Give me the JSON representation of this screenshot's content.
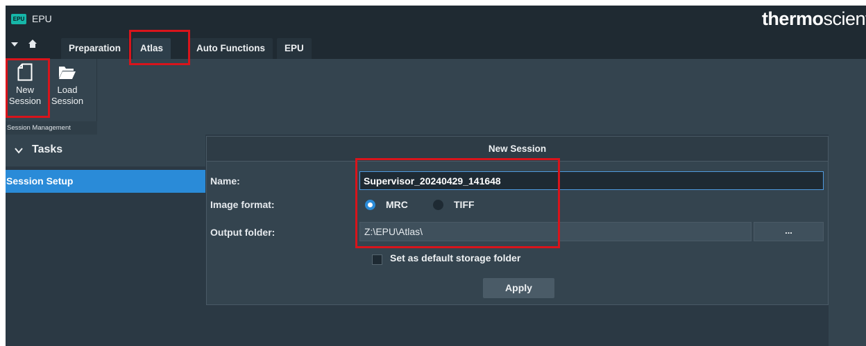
{
  "app": {
    "logo_text": "EPU",
    "title": "EPU",
    "brand_bold": "thermo",
    "brand_light": "scient"
  },
  "tabs": [
    {
      "label": "Preparation",
      "active": false
    },
    {
      "label": "Atlas",
      "active": true
    },
    {
      "label": "Auto Functions",
      "active": false
    },
    {
      "label": "EPU",
      "active": false
    }
  ],
  "ribbon": {
    "new_session_line1": "New",
    "new_session_line2": "Session",
    "load_session_line1": "Load",
    "load_session_line2": "Session",
    "group_label": "Session Management"
  },
  "tasks": {
    "title": "Tasks",
    "items": [
      {
        "label": "Session Setup",
        "selected": true
      }
    ]
  },
  "new_session_panel": {
    "title": "New Session",
    "name_label": "Name:",
    "name_value": "Supervisor_20240429_141648",
    "image_format_label": "Image format:",
    "format_options": [
      {
        "label": "MRC",
        "checked": true
      },
      {
        "label": "TIFF",
        "checked": false
      }
    ],
    "output_folder_label": "Output folder:",
    "output_folder_value": "Z:\\EPU\\Atlas\\",
    "browse_label": "...",
    "default_folder_label": "Set as default storage folder",
    "default_folder_checked": false,
    "apply_label": "Apply"
  },
  "colors": {
    "accent": "#2a8bd8",
    "highlight": "#d9141b",
    "background": "#2b3944",
    "brand_teal": "#16b6a8"
  }
}
